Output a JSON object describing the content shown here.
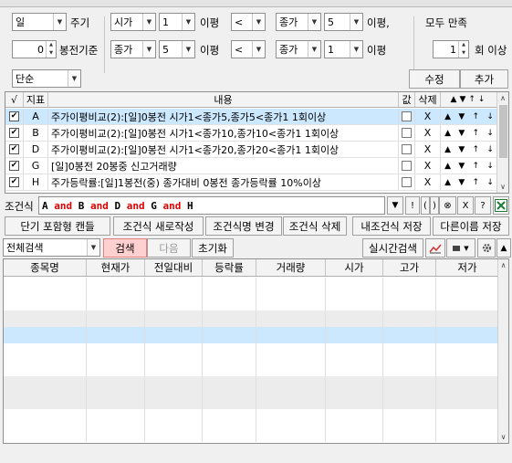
{
  "settings": {
    "row1": {
      "period_value": "일",
      "period_label": "주기",
      "left_field": "시가",
      "left_n": "1",
      "left_suffix": "이평",
      "op": "<",
      "right_field": "종가",
      "right_n": "5",
      "right_suffix": "이평,",
      "all_satisfy": "모두 만족"
    },
    "row2": {
      "base_value": "0",
      "base_label": "봉전기준",
      "left_field": "종가",
      "left_n": "5",
      "left_suffix": "이평",
      "op": "<",
      "right_field": "종가",
      "right_n": "1",
      "right_suffix": "이평",
      "count_value": "1",
      "count_label": "회 이상"
    },
    "mode_value": "단순",
    "edit_button": "수정",
    "add_button": "추가"
  },
  "indicator_table": {
    "headers": {
      "check": "√",
      "index": "지표",
      "content": "내용",
      "value": "값",
      "delete": "삭제"
    },
    "rows": [
      {
        "checked": "✔",
        "index": "A",
        "content": "주가이평비교(2):[일]0봉전 시가1<종가5,종가5<종가1 1회이상",
        "delete": "X",
        "selected": true
      },
      {
        "checked": "✔",
        "index": "B",
        "content": "주가이평비교(2):[일]0봉전 시가1<종가10,종가10<종가1 1회이상",
        "delete": "X",
        "selected": false
      },
      {
        "checked": "✔",
        "index": "D",
        "content": "주가이평비교(2):[일]0봉전 시가1<종가20,종가20<종가1 1회이상",
        "delete": "X",
        "selected": false
      },
      {
        "checked": "✔",
        "index": "G",
        "content": "[일]0봉전 20봉중 신고거래량",
        "delete": "X",
        "selected": false
      },
      {
        "checked": "✔",
        "index": "H",
        "content": "주가등락률:[일]1봉전(중) 종가대비 0봉전 종가등락률 10%이상",
        "delete": "X",
        "selected": false
      }
    ]
  },
  "condition": {
    "label": "조건식",
    "expression": [
      {
        "text": "A",
        "kind": "term"
      },
      {
        "text": " and ",
        "kind": "op"
      },
      {
        "text": "B",
        "kind": "term"
      },
      {
        "text": " and ",
        "kind": "op"
      },
      {
        "text": "D",
        "kind": "term"
      },
      {
        "text": " and ",
        "kind": "op"
      },
      {
        "text": "G",
        "kind": "term"
      },
      {
        "text": " and ",
        "kind": "op"
      },
      {
        "text": "H",
        "kind": "term"
      }
    ],
    "buttons": [
      "!",
      "(",
      ")",
      "⊗",
      "X",
      "?"
    ]
  },
  "actions": {
    "short_candle": "단기 포함형 캔들",
    "new_condition": "조건식 새로작성",
    "rename": "조건식명 변경",
    "delete": "조건식 삭제",
    "save": "내조건식 저장",
    "save_as": "다른이름 저장"
  },
  "search": {
    "scope_value": "전체검색",
    "search_button": "검색",
    "next_button": "다음",
    "reset_button": "초기화",
    "realtime_button": "실시간검색"
  },
  "results_table": {
    "headers": [
      "종목명",
      "현재가",
      "전일대비",
      "등락률",
      "거래량",
      "시가",
      "고가",
      "저가"
    ],
    "rows": []
  },
  "colors": {
    "selected_row": "#cce8ff",
    "search_bg": "#ffd0d0",
    "op_red": "#e00000"
  }
}
